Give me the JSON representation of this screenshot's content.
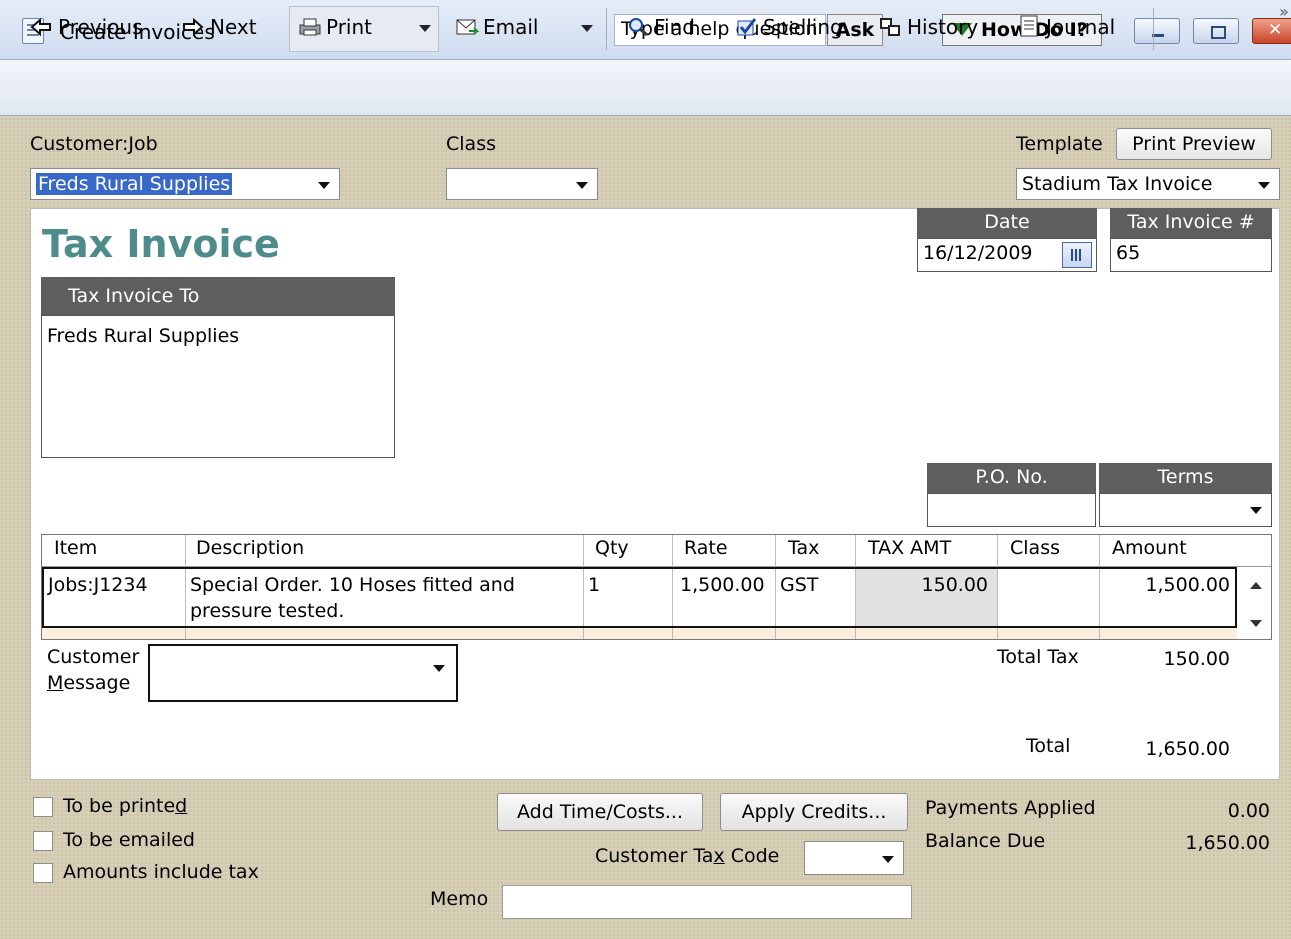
{
  "window": {
    "title": "Create Invoices"
  },
  "help": {
    "placeholder": "Type a help question",
    "ask_label": "Ask",
    "howdoi_label": "How Do I?"
  },
  "toolbar": {
    "previous": "Previous",
    "next": "Next",
    "print": "Print",
    "email": "Email",
    "find": "Find",
    "spelling": "Spelling",
    "history": "History",
    "journal": "Journal",
    "more": "»"
  },
  "header": {
    "customer_label_pre": "Customer:",
    "customer_label_u": "J",
    "customer_label_post": "ob",
    "customer_value": "Freds Rural Supplies",
    "class_label": "Class",
    "class_value": "",
    "template_label": "Template",
    "template_value": "Stadium Tax Invoice",
    "print_preview": "Print Preview"
  },
  "invoice": {
    "title": "Tax Invoice",
    "date_label": "Date",
    "date_value": "16/12/2009",
    "number_label": "Tax Invoice #",
    "number_value": "65",
    "bill_to_label": "Tax Invoice To",
    "bill_to_value": "Freds Rural Supplies",
    "po_label": "P.O. No.",
    "po_value": "",
    "terms_label": "Terms",
    "terms_value": ""
  },
  "grid": {
    "columns": [
      "Item",
      "Description",
      "Qty",
      "Rate",
      "Tax",
      "TAX AMT",
      "Class",
      "Amount"
    ],
    "rows": [
      {
        "item": "Jobs:J1234",
        "description_line1": "Special Order.  10 Hoses fitted and",
        "description_line2": "pressure tested.",
        "qty": "1",
        "rate": "1,500.00",
        "tax": "GST",
        "tax_amt": "150.00",
        "class": "",
        "amount": "1,500.00"
      }
    ]
  },
  "message": {
    "label_line1": "Customer",
    "label_line2_u": "M",
    "label_line2_rest": "essage",
    "value": ""
  },
  "totals": {
    "total_tax_label": "Total Tax",
    "total_tax_value": "150.00",
    "total_label": "Total",
    "total_value": "1,650.00",
    "payments_applied_label": "Payments Applied",
    "payments_applied_value": "0.00",
    "balance_due_label": "Balance Due",
    "balance_due_value": "1,650.00"
  },
  "options": {
    "to_be_printed_pre": "To be printe",
    "to_be_printed_u": "d",
    "to_be_emailed": "To be emailed",
    "amounts_include_tax": "Amounts include tax"
  },
  "buttons": {
    "add_time_costs": "Add Time/Costs...",
    "apply_credits": "Apply Credits..."
  },
  "tax_code": {
    "label_pre": "Customer Ta",
    "label_u": "x",
    "label_post": " Code",
    "value": ""
  },
  "memo": {
    "label": "Memo",
    "value": ""
  },
  "colors": {
    "title_teal": "#4e8c8c",
    "header_gray": "#5e5e5e",
    "selection_blue": "#3868c8"
  }
}
